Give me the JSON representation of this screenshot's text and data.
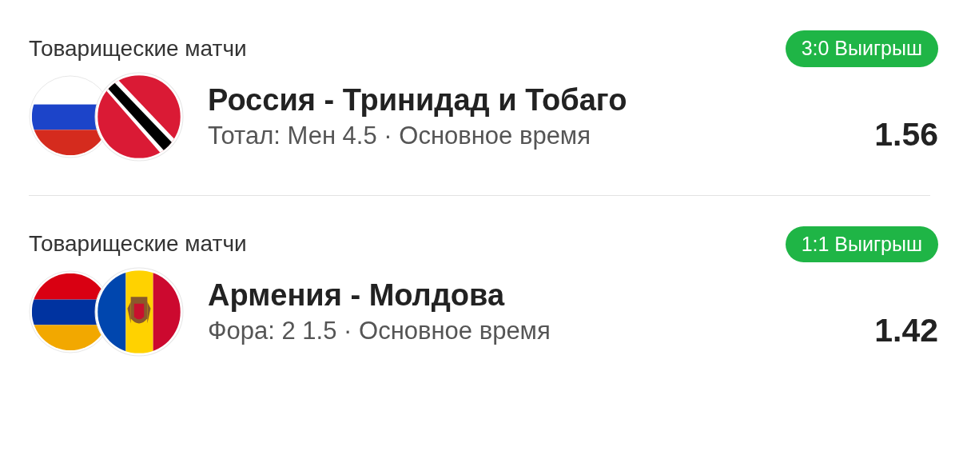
{
  "bets": [
    {
      "league": "Товарищеские матчи",
      "result": "3:0 Выигрыш",
      "flags": [
        {
          "kind": "russia"
        },
        {
          "kind": "trinidad"
        }
      ],
      "title": "Россия - Тринидад и Тобаго",
      "subtitle": "Тотал: Мен 4.5 · Основное время",
      "odds": "1.56"
    },
    {
      "league": "Товарищеские матчи",
      "result": "1:1 Выигрыш",
      "flags": [
        {
          "kind": "armenia"
        },
        {
          "kind": "moldova"
        }
      ],
      "title": "Армения - Молдова",
      "subtitle": "Фора: 2 1.5 · Основное время",
      "odds": "1.42"
    }
  ]
}
